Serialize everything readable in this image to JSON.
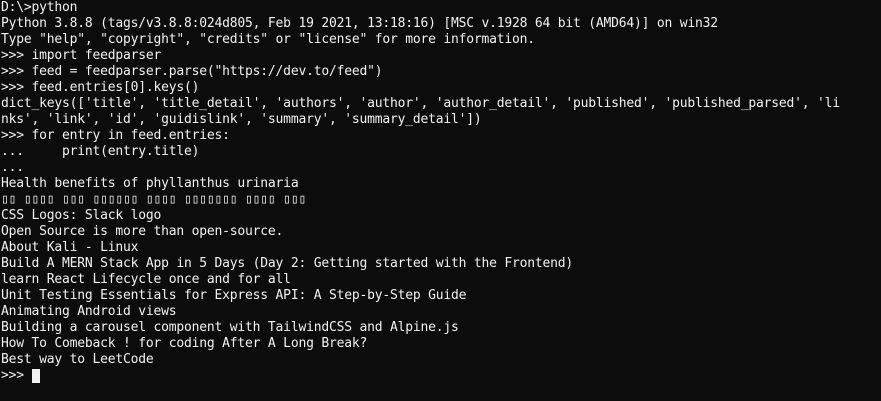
{
  "console": {
    "lines": [
      "D:\\>python",
      "Python 3.8.8 (tags/v3.8.8:024d805, Feb 19 2021, 13:18:16) [MSC v.1928 64 bit (AMD64)] on win32",
      "Type \"help\", \"copyright\", \"credits\" or \"license\" for more information.",
      ">>> import feedparser",
      ">>> feed = feedparser.parse(\"https://dev.to/feed\")",
      ">>> feed.entries[0].keys()",
      "dict_keys(['title', 'title_detail', 'authors', 'author', 'author_detail', 'published', 'published_parsed', 'li",
      "nks', 'link', 'id', 'guidislink', 'summary', 'summary_detail'])",
      ">>> for entry in feed.entries:",
      "...     print(entry.title)",
      "...",
      "Health benefits of phyllanthus urinaria",
      "▯▯ ▯▯▯▯ ▯▯▯ ▯▯▯▯▯▯ ▯▯▯▯ ▯▯▯▯▯▯▯ ▯▯▯▯ ▯▯▯",
      "CSS Logos: Slack logo",
      "Open Source is more than open-source.",
      "About Kali - Linux",
      "Build A MERN Stack App in 5 Days (Day 2: Getting started with the Frontend)",
      "learn React Lifecycle once and for all",
      "Unit Testing Essentials for Express API: A Step-by-Step Guide",
      "Animating Android views",
      "Building a carousel component with TailwindCSS and Alpine.js",
      "How To Comeback ! for coding After A Long Break?",
      "Best way to LeetCode"
    ],
    "prompt": ">>> "
  }
}
